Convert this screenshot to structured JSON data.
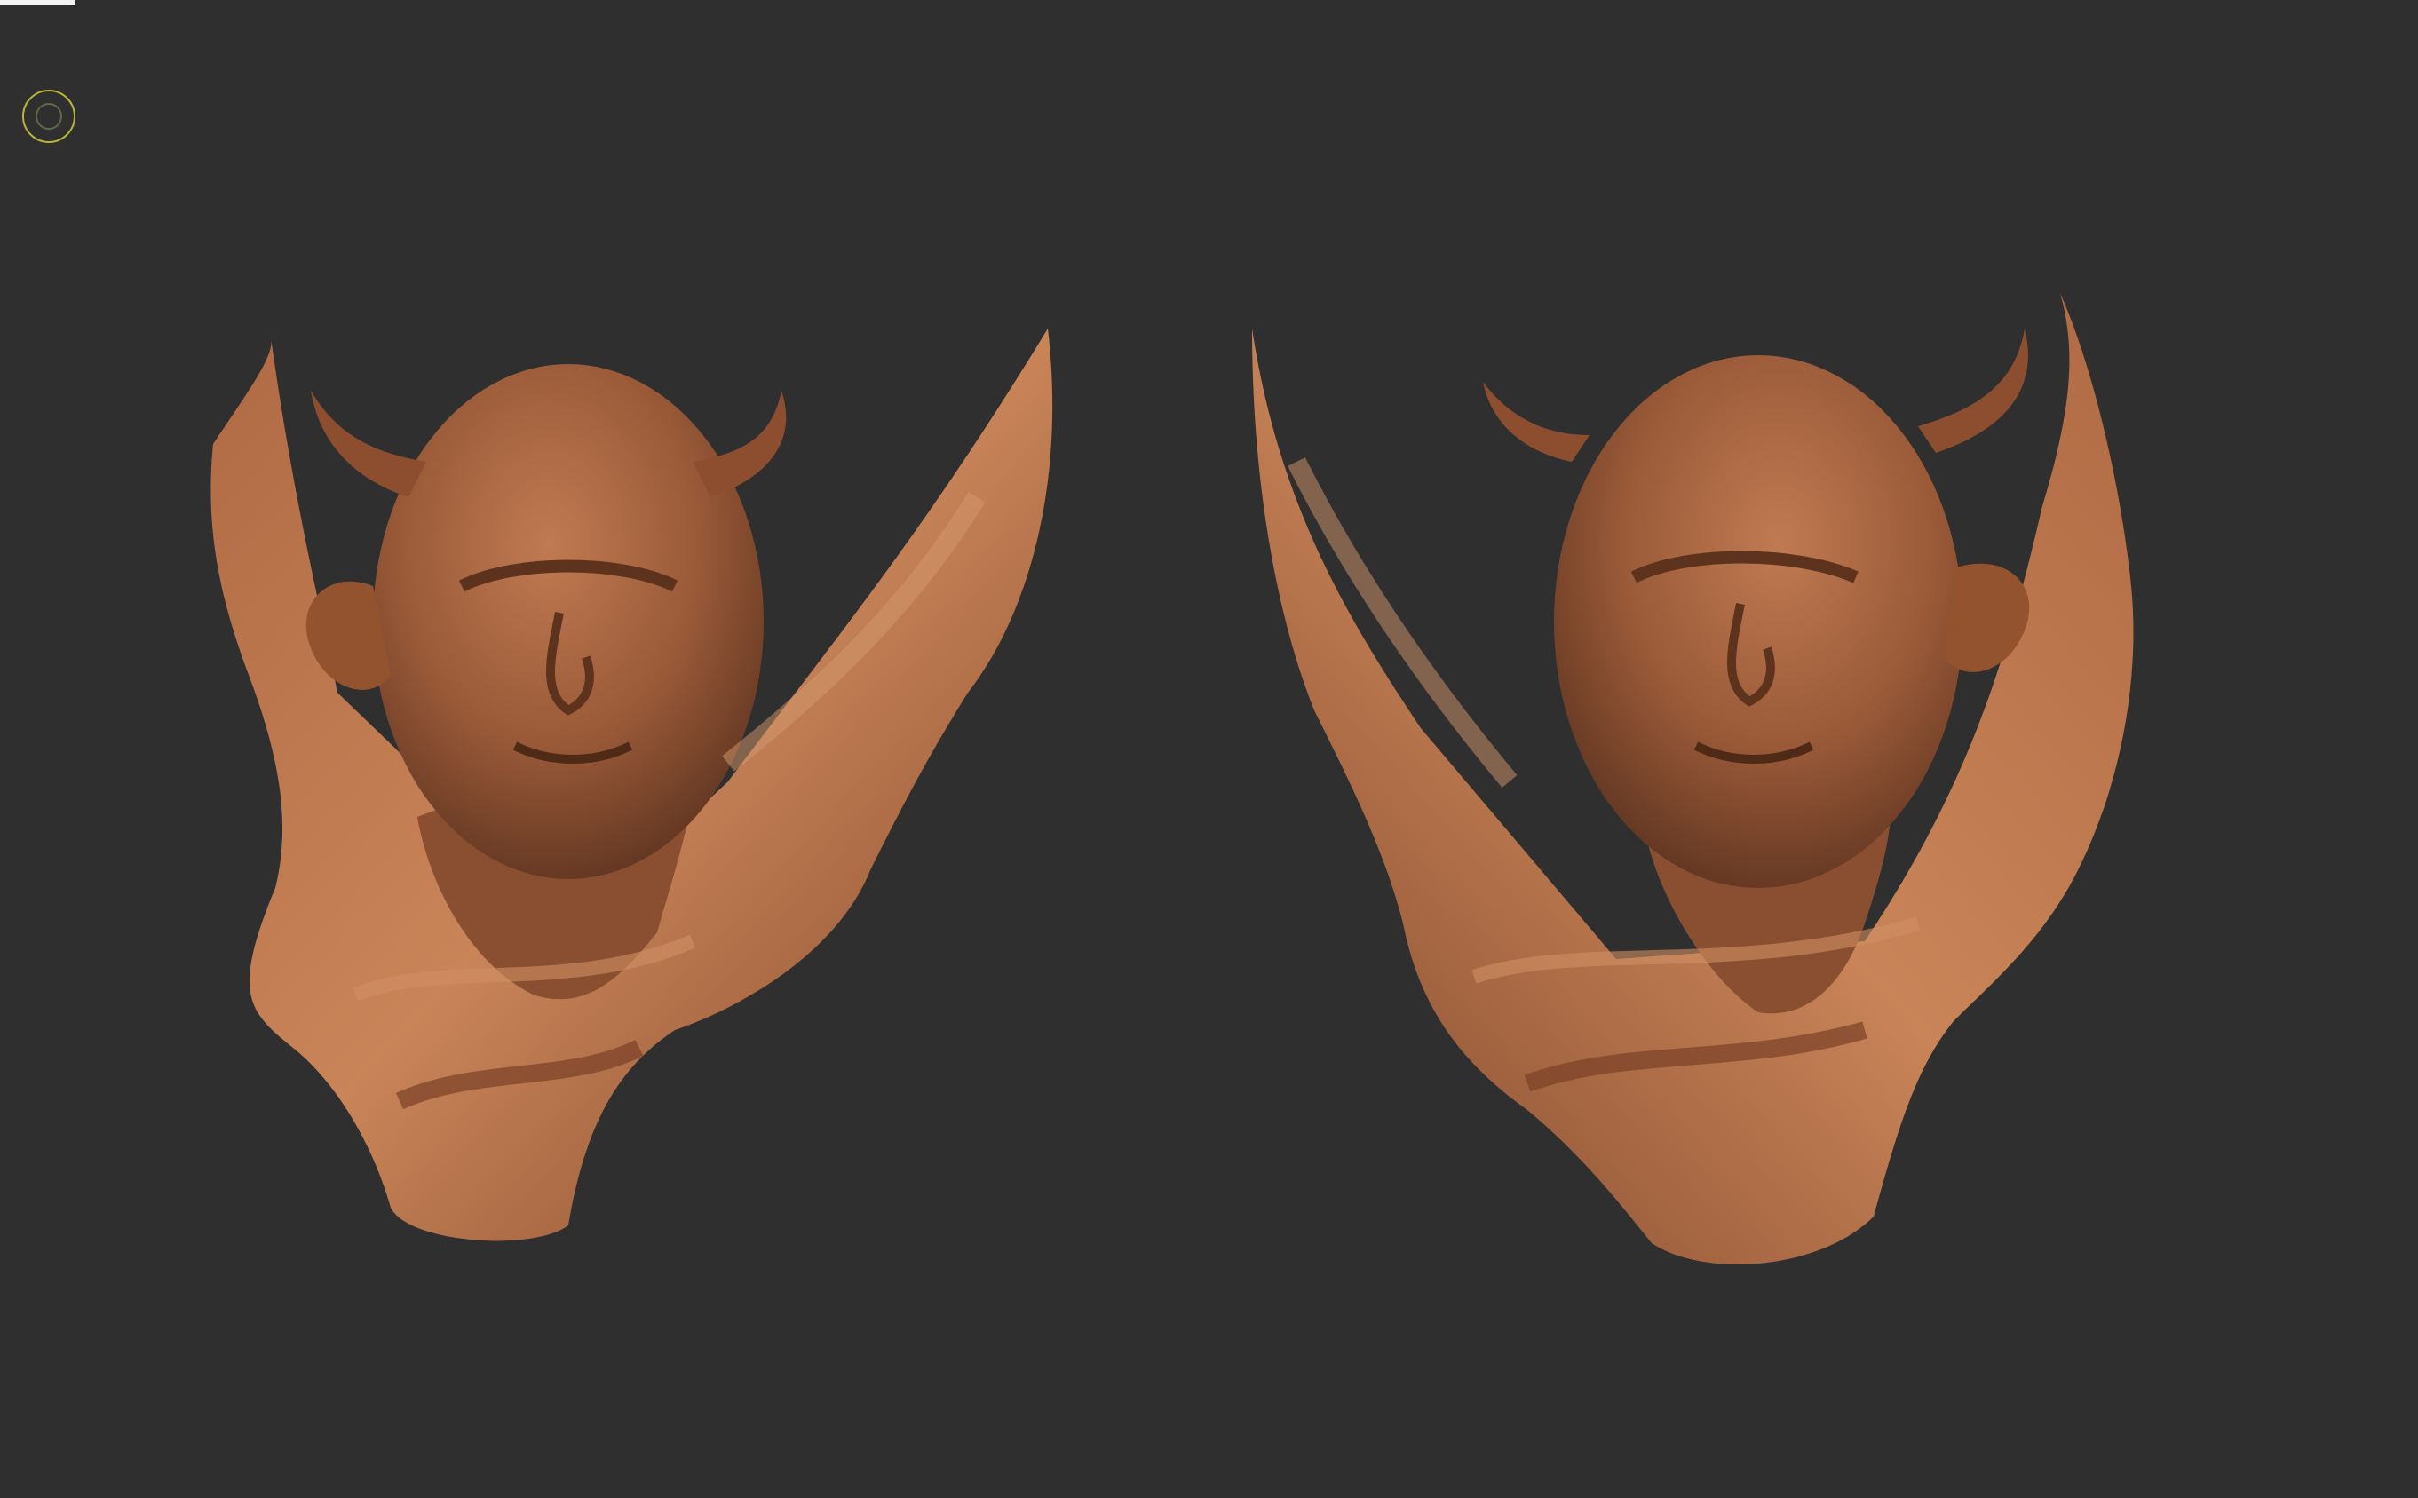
{
  "viewport": {
    "background_color": "#2f2f2f"
  },
  "toolbar_marker": {
    "color": "#f2f2f2"
  },
  "brush_cursor": {
    "icon": "circle-brush-cursor-icon",
    "color": "#b7b53a"
  },
  "models": [
    {
      "name": "demon-bust-front-left-view",
      "material_color": "#a8603c"
    },
    {
      "name": "demon-bust-front-right-view",
      "material_color": "#a8603c"
    }
  ]
}
